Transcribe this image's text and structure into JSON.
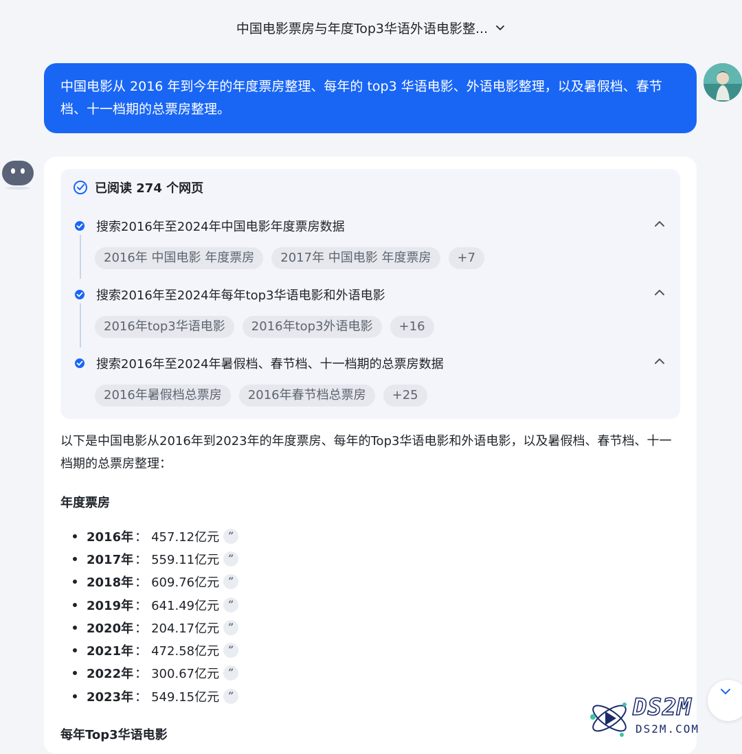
{
  "header": {
    "title": "中国电影票房与年度Top3华语外语电影整..."
  },
  "user_message": "中国电影从 2016 年到今年的年度票房整理、每年的 top3 华语电影、外语电影整理，以及暑假档、春节档、十一档期的总票房整理。",
  "sources": {
    "read_label": "已阅读 274 个网页",
    "steps": [
      {
        "label": "搜索2016年至2024年中国电影年度票房数据",
        "chips": [
          "2016年 中国电影 年度票房",
          "2017年 中国电影 年度票房",
          "+7"
        ]
      },
      {
        "label": "搜索2016年至2024年每年top3华语电影和外语电影",
        "chips": [
          "2016年top3华语电影",
          "2016年top3外语电影",
          "+16"
        ]
      },
      {
        "label": "搜索2016年至2024年暑假档、春节档、十一档期的总票房数据",
        "chips": [
          "2016年暑假档总票房",
          "2016年春节档总票房",
          "+25"
        ]
      }
    ]
  },
  "answer": {
    "intro": "以下是中国电影从2016年到2023年的年度票房、每年的Top3华语电影和外语电影，以及暑假档、春节档、十一档期的总票房整理：",
    "section1_title": "年度票房",
    "annual_box_office": [
      {
        "year": "2016年",
        "value": "457.12亿元"
      },
      {
        "year": "2017年",
        "value": "559.11亿元"
      },
      {
        "year": "2018年",
        "value": "609.76亿元"
      },
      {
        "year": "2019年",
        "value": "641.49亿元"
      },
      {
        "year": "2020年",
        "value": "204.17亿元"
      },
      {
        "year": "2021年",
        "value": "472.58亿元"
      },
      {
        "year": "2022年",
        "value": "300.67亿元"
      },
      {
        "year": "2023年",
        "value": "549.15亿元"
      }
    ],
    "separator": "：",
    "cite_glyph": "”",
    "section2_title": "每年Top3华语电影"
  },
  "watermark": {
    "brand": "DS2M",
    "url": "DS2M.COM"
  },
  "colors": {
    "accent": "#1966f5",
    "step_dot": "#1966f5"
  }
}
